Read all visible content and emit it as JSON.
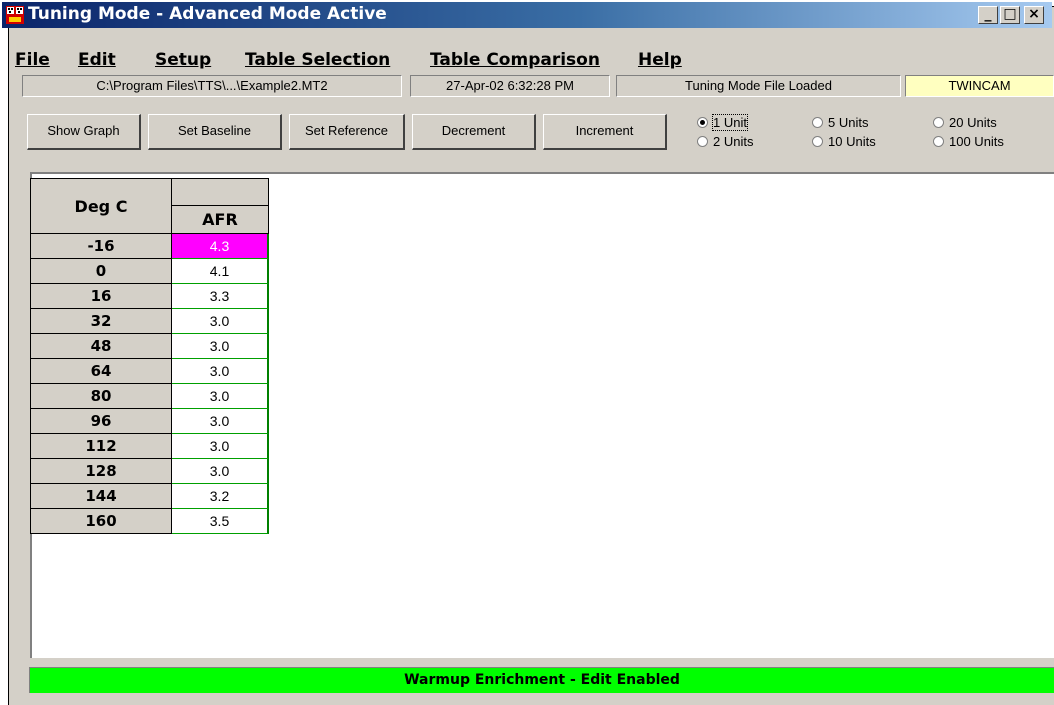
{
  "window": {
    "title": "Tuning Mode - Advanced Mode Active",
    "title_bar_colors": [
      "#0a246a",
      "#a6caf0"
    ],
    "controls": {
      "minimize": "_",
      "maximize": "□",
      "close": "×"
    }
  },
  "menu": [
    {
      "label": "File"
    },
    {
      "label": "Edit"
    },
    {
      "label": "Setup"
    },
    {
      "label": "Table Selection"
    },
    {
      "label": "Table Comparison"
    },
    {
      "label": "Help"
    }
  ],
  "status": {
    "file_path": "C:\\Program Files\\TTS\\...\\Example2.MT2",
    "timestamp": "27-Apr-02 6:32:28 PM",
    "state": "Tuning Mode File Loaded",
    "engine": "TWINCAM",
    "engine_bg": "#ffffc0"
  },
  "toolbar": {
    "show_graph": "Show Graph",
    "set_baseline": "Set Baseline",
    "set_reference": "Set Reference",
    "decrement": "Decrement",
    "increment": "Increment"
  },
  "step_options": [
    {
      "label": "1 Unit",
      "selected": true
    },
    {
      "label": "2 Units",
      "selected": false
    },
    {
      "label": "5 Units",
      "selected": false
    },
    {
      "label": "10 Units",
      "selected": false
    },
    {
      "label": "20 Units",
      "selected": false
    },
    {
      "label": "100 Units",
      "selected": false
    }
  ],
  "table": {
    "row_header": "Deg C",
    "column_header": "AFR",
    "highlight_color": "#ff00ff",
    "rows": [
      {
        "deg": "-16",
        "afr": "4.3",
        "highlight": true
      },
      {
        "deg": "0",
        "afr": "4.1"
      },
      {
        "deg": "16",
        "afr": "3.3"
      },
      {
        "deg": "32",
        "afr": "3.0"
      },
      {
        "deg": "48",
        "afr": "3.0"
      },
      {
        "deg": "64",
        "afr": "3.0"
      },
      {
        "deg": "80",
        "afr": "3.0"
      },
      {
        "deg": "96",
        "afr": "3.0"
      },
      {
        "deg": "112",
        "afr": "3.0"
      },
      {
        "deg": "128",
        "afr": "3.0"
      },
      {
        "deg": "144",
        "afr": "3.2"
      },
      {
        "deg": "160",
        "afr": "3.5"
      }
    ]
  },
  "footer": {
    "message": "Warmup Enrichment - Edit Enabled",
    "bg": "#00ff00"
  }
}
